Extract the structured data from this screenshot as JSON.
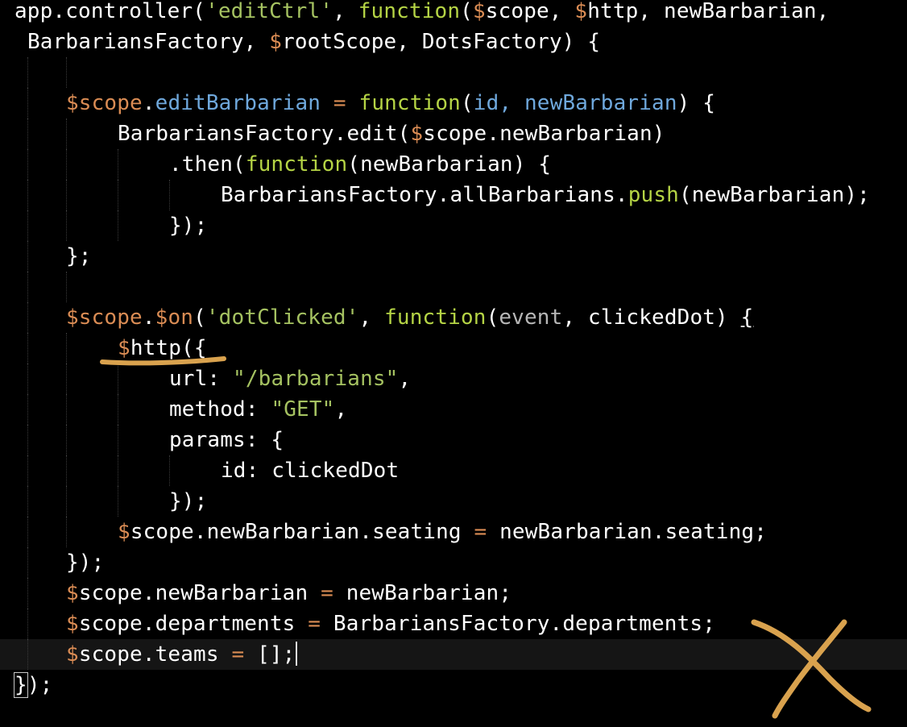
{
  "editor": {
    "colors": {
      "background": "#000000",
      "current_line": "#151515",
      "string": "#a5c261",
      "keyword": "#b5d445",
      "variable": "#da8c54",
      "property": "#6fa8dc",
      "text": "#ffffff",
      "annotation": "#d9a24e"
    },
    "lines": [
      {
        "indent": 0,
        "tokens": [
          {
            "t": "app.controller(",
            "c": "plain"
          },
          {
            "t": "'editCtrl'",
            "c": "string"
          },
          {
            "t": ", ",
            "c": "plain"
          },
          {
            "t": "function",
            "c": "keyword"
          },
          {
            "t": "(",
            "c": "plain"
          },
          {
            "t": "$",
            "c": "var"
          },
          {
            "t": "scope, ",
            "c": "plain"
          },
          {
            "t": "$",
            "c": "var"
          },
          {
            "t": "http, newBarbarian,",
            "c": "plain"
          }
        ]
      },
      {
        "indent": 1,
        "tokens": [
          {
            "t": "BarbariansFactory, ",
            "c": "plain"
          },
          {
            "t": "$",
            "c": "var"
          },
          {
            "t": "rootScope, DotsFactory) {",
            "c": "plain"
          }
        ]
      },
      {
        "indent": 0,
        "tokens": []
      },
      {
        "indent": 4,
        "tokens": [
          {
            "t": "$scope",
            "c": "var"
          },
          {
            "t": ".",
            "c": "plain"
          },
          {
            "t": "editBarbarian",
            "c": "prop"
          },
          {
            "t": " = ",
            "c": "op"
          },
          {
            "t": "function",
            "c": "keyword"
          },
          {
            "t": "(",
            "c": "plain"
          },
          {
            "t": "id, newBarbarian",
            "c": "prop"
          },
          {
            "t": ") {",
            "c": "plain"
          }
        ]
      },
      {
        "indent": 8,
        "tokens": [
          {
            "t": "BarbariansFactory.edit(",
            "c": "plain"
          },
          {
            "t": "$",
            "c": "var"
          },
          {
            "t": "scope.newBarbarian)",
            "c": "plain"
          }
        ]
      },
      {
        "indent": 12,
        "tokens": [
          {
            "t": ".then(",
            "c": "plain"
          },
          {
            "t": "function",
            "c": "keyword"
          },
          {
            "t": "(newBarbarian) {",
            "c": "plain"
          }
        ]
      },
      {
        "indent": 16,
        "tokens": [
          {
            "t": "BarbariansFactory.allBarbarians.",
            "c": "plain"
          },
          {
            "t": "push",
            "c": "keyword"
          },
          {
            "t": "(newBarbarian);",
            "c": "plain"
          }
        ]
      },
      {
        "indent": 12,
        "tokens": [
          {
            "t": "});",
            "c": "plain"
          }
        ]
      },
      {
        "indent": 4,
        "tokens": [
          {
            "t": "};",
            "c": "plain"
          }
        ]
      },
      {
        "indent": 0,
        "tokens": []
      },
      {
        "indent": 4,
        "tokens": [
          {
            "t": "$scope",
            "c": "var"
          },
          {
            "t": ".",
            "c": "plain"
          },
          {
            "t": "$on",
            "c": "var"
          },
          {
            "t": "(",
            "c": "plain"
          },
          {
            "t": "'dotClicked'",
            "c": "string"
          },
          {
            "t": ", ",
            "c": "plain"
          },
          {
            "t": "function",
            "c": "keyword"
          },
          {
            "t": "(",
            "c": "plain"
          },
          {
            "t": "event",
            "c": "param"
          },
          {
            "t": ", clickedDot) ",
            "c": "plain"
          },
          {
            "t": "{",
            "c": "plain",
            "mark": "underline"
          }
        ]
      },
      {
        "indent": 8,
        "tokens": [
          {
            "t": "$",
            "c": "var"
          },
          {
            "t": "http({",
            "c": "plain"
          }
        ]
      },
      {
        "indent": 12,
        "tokens": [
          {
            "t": "url: ",
            "c": "plain"
          },
          {
            "t": "\"/barbarians\"",
            "c": "string"
          },
          {
            "t": ",",
            "c": "plain"
          }
        ]
      },
      {
        "indent": 12,
        "tokens": [
          {
            "t": "method: ",
            "c": "plain"
          },
          {
            "t": "\"GET\"",
            "c": "string"
          },
          {
            "t": ",",
            "c": "plain"
          }
        ]
      },
      {
        "indent": 12,
        "tokens": [
          {
            "t": "params: {",
            "c": "plain"
          }
        ]
      },
      {
        "indent": 16,
        "tokens": [
          {
            "t": "id: clickedDot",
            "c": "plain"
          }
        ]
      },
      {
        "indent": 12,
        "tokens": [
          {
            "t": "});",
            "c": "plain"
          }
        ]
      },
      {
        "indent": 8,
        "tokens": [
          {
            "t": "$",
            "c": "var"
          },
          {
            "t": "scope.newBarbarian.seating ",
            "c": "plain"
          },
          {
            "t": "=",
            "c": "op"
          },
          {
            "t": " newBarbarian.seating;",
            "c": "plain"
          }
        ]
      },
      {
        "indent": 4,
        "tokens": [
          {
            "t": "});",
            "c": "plain"
          }
        ]
      },
      {
        "indent": 4,
        "tokens": [
          {
            "t": "$",
            "c": "var"
          },
          {
            "t": "scope.newBarbarian ",
            "c": "plain"
          },
          {
            "t": "=",
            "c": "op"
          },
          {
            "t": " newBarbarian;",
            "c": "plain"
          }
        ]
      },
      {
        "indent": 4,
        "tokens": [
          {
            "t": "$",
            "c": "var"
          },
          {
            "t": "scope.departments ",
            "c": "plain"
          },
          {
            "t": "=",
            "c": "op"
          },
          {
            "t": " BarbariansFactory.departments;",
            "c": "plain"
          }
        ]
      },
      {
        "indent": 4,
        "current": true,
        "caret": true,
        "tokens": [
          {
            "t": "$",
            "c": "var"
          },
          {
            "t": "scope.teams ",
            "c": "plain"
          },
          {
            "t": "=",
            "c": "op"
          },
          {
            "t": " [];",
            "c": "plain"
          }
        ]
      },
      {
        "indent": 0,
        "tokens": [
          {
            "t": "}",
            "c": "plain",
            "mark": "box"
          },
          {
            "t": ");",
            "c": "plain"
          }
        ]
      }
    ]
  },
  "annotations": {
    "underline_target": "$http({",
    "cross_mark": "x-mark-icon",
    "color": "#d9a24e"
  }
}
